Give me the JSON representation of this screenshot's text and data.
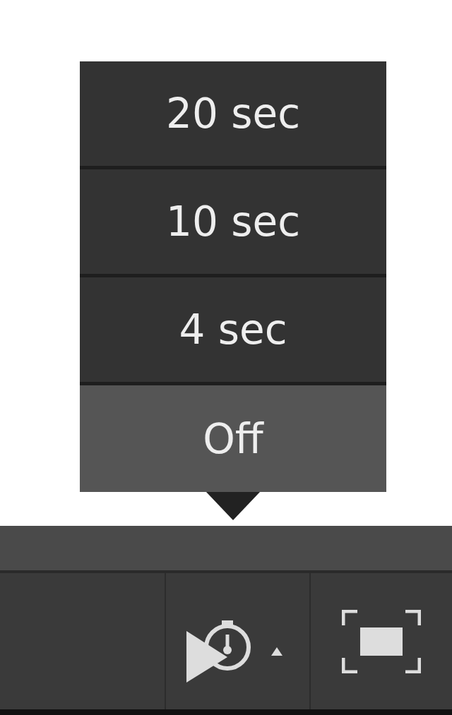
{
  "timer_menu": {
    "items": [
      {
        "label": "20 sec",
        "selected": false
      },
      {
        "label": "10 sec",
        "selected": false
      },
      {
        "label": "4 sec",
        "selected": false
      },
      {
        "label": "Off",
        "selected": true
      }
    ]
  }
}
